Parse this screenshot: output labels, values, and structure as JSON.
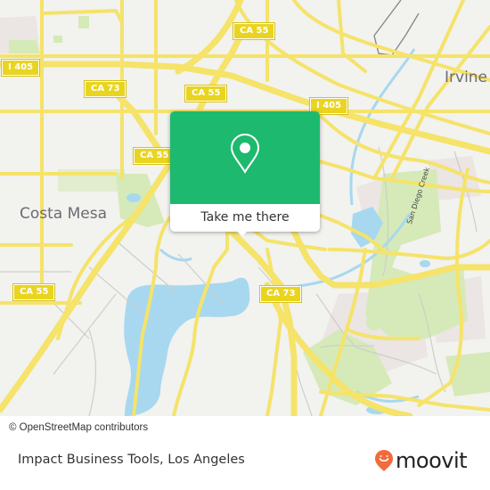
{
  "map": {
    "cities": [
      {
        "name": "Costa Mesa"
      },
      {
        "name": "Irvine"
      }
    ],
    "shields": [
      {
        "label": "I 405"
      },
      {
        "label": "CA 73"
      },
      {
        "label": "CA 55"
      },
      {
        "label": "CA 55"
      },
      {
        "label": "I 405"
      },
      {
        "label": "CA 55"
      },
      {
        "label": "CA 55"
      },
      {
        "label": "CA 73"
      }
    ],
    "waterway_label": "San Diego Creek",
    "colors": {
      "land": "#f2f2ef",
      "road": "#f5e36a",
      "water": "#a7d8ef",
      "park": "#d5eab8",
      "accent": "#1db96e"
    }
  },
  "popup": {
    "icon": "location-pin-icon",
    "cta_label": "Take me there"
  },
  "attribution": "© OpenStreetMap contributors",
  "footer": {
    "title": "Impact Business Tools, Los Angeles",
    "brand": "moovit",
    "brand_color": "#f26b3a"
  }
}
